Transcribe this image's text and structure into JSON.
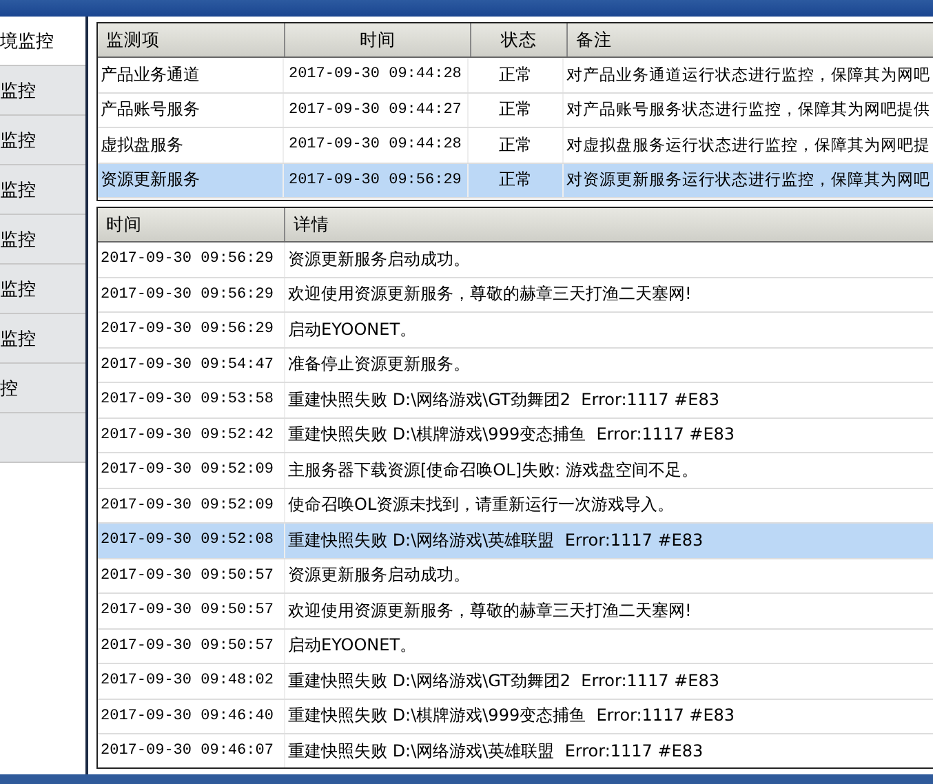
{
  "sidebar": {
    "items": [
      {
        "label": "境监控",
        "selected": true
      },
      {
        "label": "监控",
        "selected": false
      },
      {
        "label": "监控",
        "selected": false
      },
      {
        "label": "监控",
        "selected": false
      },
      {
        "label": "监控",
        "selected": false
      },
      {
        "label": "监控",
        "selected": false
      },
      {
        "label": "监控",
        "selected": false
      },
      {
        "label": "控",
        "selected": false
      },
      {
        "selected": false
      }
    ]
  },
  "monitor_table": {
    "columns": [
      "监测项",
      "时间",
      "状态",
      "备注"
    ],
    "rows": [
      {
        "item": "产品业务通道",
        "time": "2017-09-30 09:44:28",
        "status": "正常",
        "note": "对产品业务通道运行状态进行监控，保障其为网吧",
        "selected": false
      },
      {
        "item": "产品账号服务",
        "time": "2017-09-30 09:44:27",
        "status": "正常",
        "note": "对产品账号服务状态进行监控，保障其为网吧提供",
        "selected": false
      },
      {
        "item": "虚拟盘服务",
        "time": "2017-09-30 09:44:28",
        "status": "正常",
        "note": "对虚拟盘服务运行状态进行监控，保障其为网吧提",
        "selected": false
      },
      {
        "item": "资源更新服务",
        "time": "2017-09-30 09:56:29",
        "status": "正常",
        "note": "对资源更新服务运行状态进行监控，保障其为网吧",
        "selected": true
      }
    ]
  },
  "log_table": {
    "columns": [
      "时间",
      "详情"
    ],
    "rows": [
      {
        "time": "2017-09-30 09:56:29",
        "detail": "资源更新服务启动成功。",
        "selected": false
      },
      {
        "time": "2017-09-30 09:56:29",
        "detail": "欢迎使用资源更新服务，尊敬的赫章三天打渔二天塞网!",
        "selected": false
      },
      {
        "time": "2017-09-30 09:56:29",
        "detail": "启动EYOONET。",
        "selected": false
      },
      {
        "time": "2017-09-30 09:54:47",
        "detail": "准备停止资源更新服务。",
        "selected": false
      },
      {
        "time": "2017-09-30 09:53:58",
        "detail": "重建快照失败 D:\\网络游戏\\GT劲舞团2  Error:1117 #E83",
        "selected": false
      },
      {
        "time": "2017-09-30 09:52:42",
        "detail": "重建快照失败 D:\\棋牌游戏\\999变态捕鱼  Error:1117 #E83",
        "selected": false
      },
      {
        "time": "2017-09-30 09:52:09",
        "detail": "主服务器下载资源[使命召唤OL]失败: 游戏盘空间不足。",
        "selected": false
      },
      {
        "time": "2017-09-30 09:52:09",
        "detail": "使命召唤OL资源未找到，请重新运行一次游戏导入。",
        "selected": false
      },
      {
        "time": "2017-09-30 09:52:08",
        "detail": "重建快照失败 D:\\网络游戏\\英雄联盟  Error:1117 #E83",
        "selected": true
      },
      {
        "time": "2017-09-30 09:50:57",
        "detail": "资源更新服务启动成功。",
        "selected": false
      },
      {
        "time": "2017-09-30 09:50:57",
        "detail": "欢迎使用资源更新服务，尊敬的赫章三天打渔二天塞网!",
        "selected": false
      },
      {
        "time": "2017-09-30 09:50:57",
        "detail": "启动EYOONET。",
        "selected": false
      },
      {
        "time": "2017-09-30 09:48:02",
        "detail": "重建快照失败 D:\\网络游戏\\GT劲舞团2  Error:1117 #E83",
        "selected": false
      },
      {
        "time": "2017-09-30 09:46:40",
        "detail": "重建快照失败 D:\\棋牌游戏\\999变态捕鱼  Error:1117 #E83",
        "selected": false
      },
      {
        "time": "2017-09-30 09:46:07",
        "detail": "重建快照失败 D:\\网络游戏\\英雄联盟  Error:1117 #E83",
        "selected": false
      }
    ]
  }
}
